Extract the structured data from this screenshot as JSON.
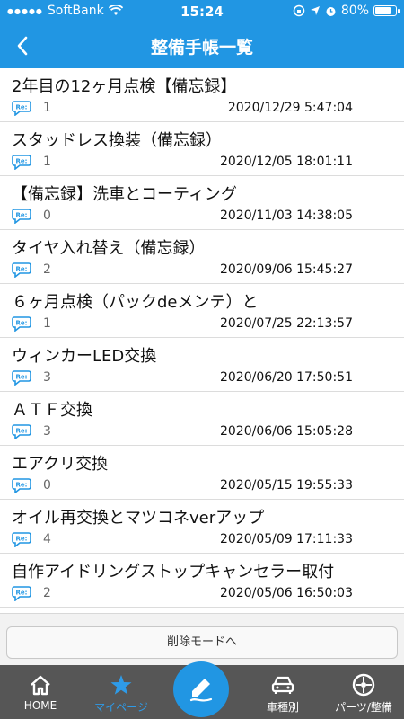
{
  "status_bar": {
    "carrier": "SoftBank",
    "time": "15:24",
    "battery_percent": "80%",
    "battery_level": 0.8
  },
  "header": {
    "title": "整備手帳一覧",
    "back_icon": "chevron-left-icon"
  },
  "records": [
    {
      "title": "2年目の12ヶ月点検【備忘録】",
      "comments": "1",
      "date": "2020/12/29 5:47:04"
    },
    {
      "title": "スタッドレス換装（備忘録）",
      "comments": "1",
      "date": "2020/12/05 18:01:11"
    },
    {
      "title": "【備忘録】洗車とコーティング",
      "comments": "0",
      "date": "2020/11/03 14:38:05"
    },
    {
      "title": "タイヤ入れ替え（備忘録）",
      "comments": "2",
      "date": "2020/09/06 15:45:27"
    },
    {
      "title": "６ヶ月点検（パックdeメンテ）と",
      "comments": "1",
      "date": "2020/07/25 22:13:57"
    },
    {
      "title": "ウィンカーLED交換",
      "comments": "3",
      "date": "2020/06/20 17:50:51"
    },
    {
      "title": "ＡＴＦ交換",
      "comments": "3",
      "date": "2020/06/06 15:05:28"
    },
    {
      "title": "エアクリ交換",
      "comments": "0",
      "date": "2020/05/15 19:55:33"
    },
    {
      "title": "オイル再交換とマツコネverアップ",
      "comments": "4",
      "date": "2020/05/09 17:11:33"
    },
    {
      "title": "自作アイドリングストップキャンセラー取付",
      "comments": "2",
      "date": "2020/05/06 16:50:03"
    }
  ],
  "actions": {
    "delete_mode_label": "削除モードへ"
  },
  "tabbar": {
    "home_label": "HOME",
    "mypage_label": "マイページ",
    "car_label": "車種別",
    "parts_label": "パーツ/整備",
    "active_tab": "mypage"
  },
  "colors": {
    "primary": "#2196e3",
    "tabbar_bg": "#565656",
    "active_tab": "#2e9be8"
  }
}
